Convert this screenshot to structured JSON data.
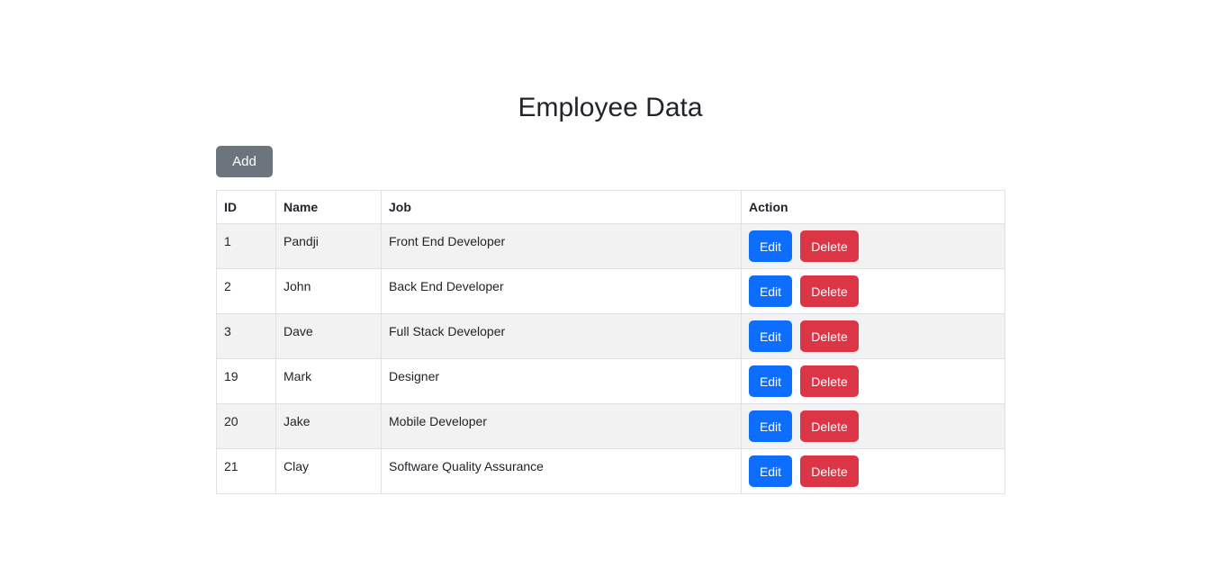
{
  "page": {
    "title": "Employee Data"
  },
  "toolbar": {
    "add_label": "Add"
  },
  "table": {
    "headers": {
      "id": "ID",
      "name": "Name",
      "job": "Job",
      "action": "Action"
    },
    "rows": [
      {
        "id": "1",
        "name": "Pandji",
        "job": "Front End Developer",
        "edit_label": "Edit",
        "delete_label": "Delete"
      },
      {
        "id": "2",
        "name": "John",
        "job": "Back End Developer",
        "edit_label": "Edit",
        "delete_label": "Delete"
      },
      {
        "id": "3",
        "name": "Dave",
        "job": "Full Stack Developer",
        "edit_label": "Edit",
        "delete_label": "Delete"
      },
      {
        "id": "19",
        "name": "Mark",
        "job": "Designer",
        "edit_label": "Edit",
        "delete_label": "Delete"
      },
      {
        "id": "20",
        "name": "Jake",
        "job": "Mobile Developer",
        "edit_label": "Edit",
        "delete_label": "Delete"
      },
      {
        "id": "21",
        "name": "Clay",
        "job": "Software Quality Assurance",
        "edit_label": "Edit",
        "delete_label": "Delete"
      }
    ]
  },
  "colors": {
    "add_button": "#6c757d",
    "edit_button": "#0d6efd",
    "delete_button": "#dc3545",
    "striped_row": "#f2f2f2",
    "border": "#dee2e6"
  }
}
